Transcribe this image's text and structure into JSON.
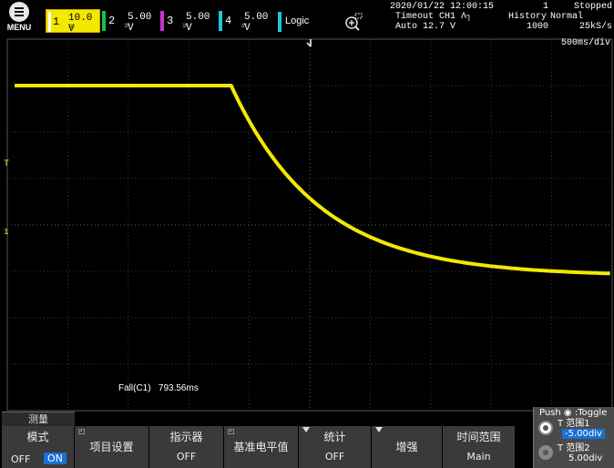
{
  "menu": {
    "label": "MENU",
    "icon": "menu-icon"
  },
  "channels": [
    {
      "num": "1",
      "volt": "10.0 V",
      "coupling": "1M",
      "color": "#f3e800",
      "active": true
    },
    {
      "num": "2",
      "volt": "5.00 V",
      "coupling": "1M",
      "color": "#19c34a"
    },
    {
      "num": "3",
      "volt": "5.00 V",
      "coupling": "1M",
      "color": "#cc33cc"
    },
    {
      "num": "4",
      "volt": "5.00 V",
      "coupling": "1M",
      "color": "#21c7d6"
    }
  ],
  "logic_label": "Logic",
  "status": {
    "datetime": "2020/01/22 12:00:15",
    "count": "1",
    "state": "Stopped",
    "trigger_line1": "Timeout CH1 Ʌ┐",
    "trigger_line2": "Auto 12.7 V",
    "history_label": "History",
    "history_value": "1000",
    "mode": "Normal",
    "sample_rate": "25kS/s"
  },
  "timebase": "500ms/div",
  "measurement": {
    "label": "Fall(C1)",
    "value": "793.56ms"
  },
  "softkeys": {
    "title": "测量",
    "mode_label": "模式",
    "mode_off": "OFF",
    "mode_on": "ON",
    "item_setup": "项目设置",
    "indicator_label": "指示器",
    "indicator_value": "OFF",
    "ref_level": "基准电平值",
    "stats_label": "统计",
    "stats_value": "OFF",
    "enhance": "增强",
    "time_range_label": "时间范围",
    "time_range_value": "Main"
  },
  "push_panel": {
    "title": "Push ◉ :Toggle",
    "range1_label": "T  范围1",
    "range1_value": "-5.00div",
    "range2_label": "T  范围2",
    "range2_value": "5.00div"
  },
  "waveform": {
    "color": "#f3e800",
    "high_level_div": 3.0,
    "low_level_div": -1.1,
    "fall_start_div": 3.7,
    "tau_div": 1.45
  },
  "markers": {
    "trigger_level": "T",
    "ground": "1"
  }
}
